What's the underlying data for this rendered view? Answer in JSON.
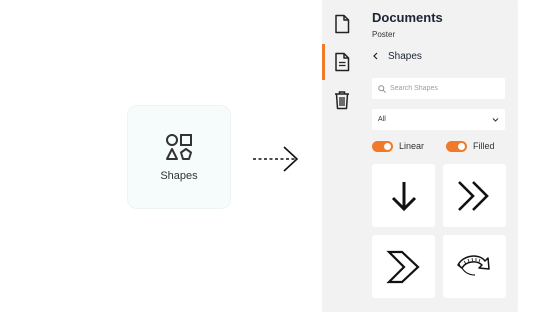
{
  "shapes_card": {
    "label": "Shapes",
    "icon": "shapes-icon"
  },
  "connector": {
    "icon": "dashed-arrow-icon"
  },
  "sidebar": {
    "items": [
      {
        "name": "document-icon",
        "active": false
      },
      {
        "name": "document-text-icon",
        "active": true
      },
      {
        "name": "trash-icon",
        "active": false
      }
    ]
  },
  "panel": {
    "title": "Documents",
    "subtitle": "Poster",
    "back_label": "Shapes",
    "search": {
      "placeholder": "Search Shapes",
      "value": ""
    },
    "filter": {
      "selected": "All"
    },
    "toggles": [
      {
        "label": "Linear",
        "on": true
      },
      {
        "label": "Filled",
        "on": true
      }
    ],
    "shapes": [
      {
        "name": "arrow-down-icon"
      },
      {
        "name": "double-chevron-right-icon"
      },
      {
        "name": "chevron-right-outline-icon"
      },
      {
        "name": "curved-arrow-icon"
      }
    ]
  },
  "colors": {
    "accent": "#f07a2a",
    "panel_bg": "#f2f2f2",
    "card_bg": "#f6fbfb"
  }
}
